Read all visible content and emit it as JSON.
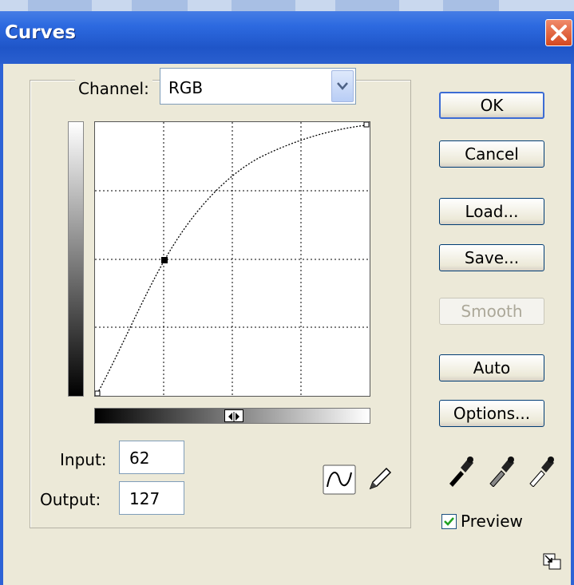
{
  "window": {
    "title": "Curves"
  },
  "channel": {
    "label": "Channel:",
    "value": "RGB"
  },
  "input": {
    "label": "Input:",
    "value": "62"
  },
  "output": {
    "label": "Output:",
    "value": "127"
  },
  "buttons": {
    "ok": "OK",
    "cancel": "Cancel",
    "load": "Load...",
    "save": "Save...",
    "smooth": "Smooth",
    "auto": "Auto",
    "options": "Options..."
  },
  "preview": {
    "label": "Preview",
    "checked": true
  },
  "curve": {
    "points": [
      [
        0,
        0
      ],
      [
        62,
        127
      ],
      [
        255,
        255
      ]
    ],
    "selected_point": [
      62,
      127
    ],
    "grid_divisions": 4
  },
  "icons": {
    "close": "close-icon",
    "dropdown": "chevron-down-icon",
    "curve_tool": "curve-tool-icon",
    "pencil_tool": "pencil-icon",
    "black_eyedropper": "eyedropper-black-icon",
    "gray_eyedropper": "eyedropper-gray-icon",
    "white_eyedropper": "eyedropper-white-icon",
    "expand": "expand-dialog-icon",
    "gradient_toggle": "gradient-toggle-icon"
  },
  "colors": {
    "title_bar": "#2d6ae0",
    "close": "#d4481f",
    "dialog_bg": "#ece9d8",
    "default_border": "#3c6cd4"
  }
}
